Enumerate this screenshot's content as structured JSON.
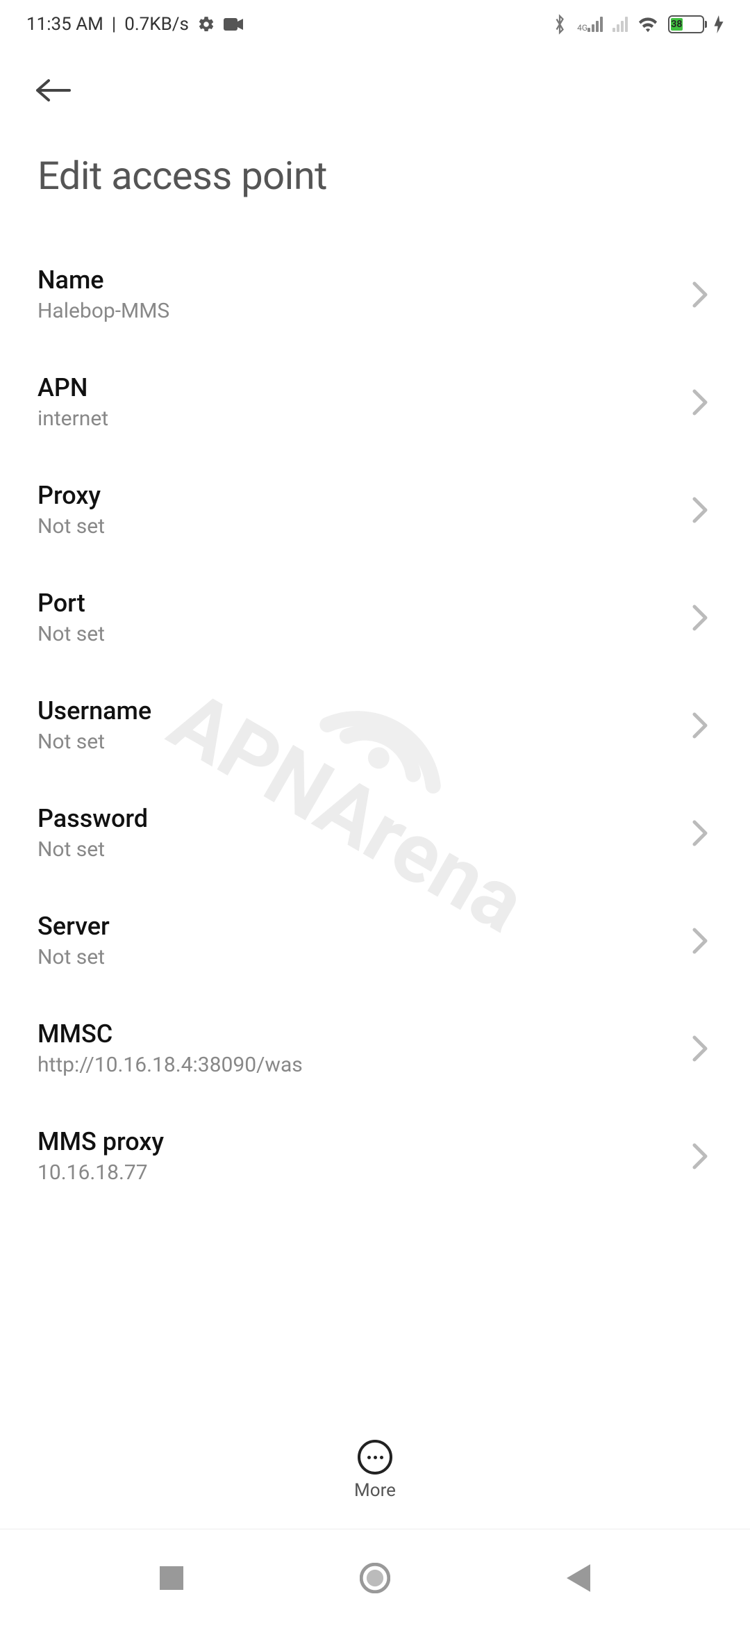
{
  "status": {
    "time": "11:35 AM",
    "speed": "0.7KB/s",
    "battery_percent": "38",
    "network_label": "4G"
  },
  "header": {
    "title": "Edit access point"
  },
  "settings": [
    {
      "label": "Name",
      "value": "Halebop-MMS",
      "key": "name"
    },
    {
      "label": "APN",
      "value": "internet",
      "key": "apn"
    },
    {
      "label": "Proxy",
      "value": "Not set",
      "key": "proxy"
    },
    {
      "label": "Port",
      "value": "Not set",
      "key": "port"
    },
    {
      "label": "Username",
      "value": "Not set",
      "key": "username"
    },
    {
      "label": "Password",
      "value": "Not set",
      "key": "password"
    },
    {
      "label": "Server",
      "value": "Not set",
      "key": "server"
    },
    {
      "label": "MMSC",
      "value": "http://10.16.18.4:38090/was",
      "key": "mmsc"
    },
    {
      "label": "MMS proxy",
      "value": "10.16.18.77",
      "key": "mmsproxy"
    }
  ],
  "bottom": {
    "more_label": "More"
  },
  "watermark": "APNArena"
}
